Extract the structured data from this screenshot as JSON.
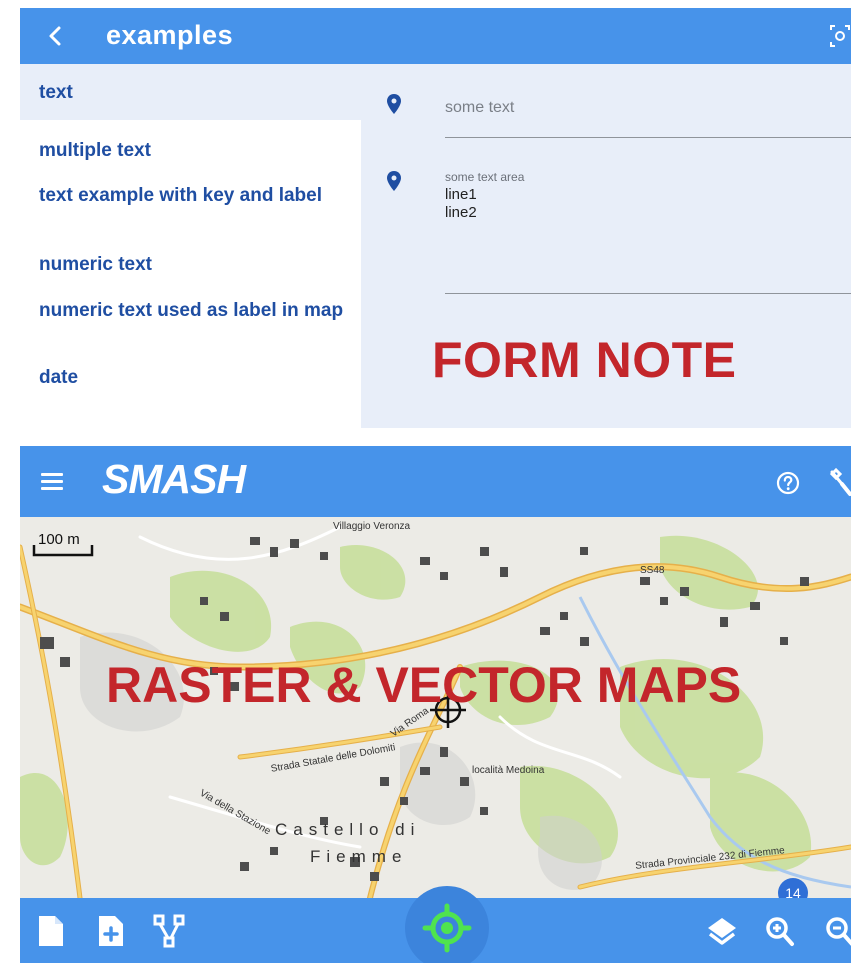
{
  "form_screen": {
    "app_bar": {
      "title": "examples"
    },
    "sections": [
      {
        "label": "text",
        "selected": true
      },
      {
        "label": "multiple text"
      },
      {
        "label": "text example with key and label"
      },
      {
        "label": "numeric text"
      },
      {
        "label": "numeric text used as label in map"
      },
      {
        "label": "date"
      }
    ],
    "fields": {
      "text_value": "some text",
      "text_area_label": "some text area",
      "text_area_line1": "line1",
      "text_area_line2": "line2"
    },
    "caption": "FORM NOTE"
  },
  "map_screen": {
    "app_bar": {
      "title": "SMASH"
    },
    "caption": "RASTER & VECTOR MAPS",
    "scale_label": "100 m",
    "zoom_level": "14",
    "place_labels": {
      "village": "Villaggio Veronza",
      "road_ss48": "SS48",
      "strada_statale": "Strada Statale delle Dolomiti",
      "via_roma": "Via Roma",
      "localita": "località Medoina",
      "via_stazione": "Via della Stazione",
      "castello": "Castello di",
      "fiemme": "Fiemme",
      "strada_provinciale": "Strada Provinciale 232 di Fiemme"
    }
  },
  "colors": {
    "app_bar": "#4793ea",
    "list_text": "#1f4ea2",
    "caption_red": "#c3262b",
    "gps_green": "#4fe34f"
  }
}
